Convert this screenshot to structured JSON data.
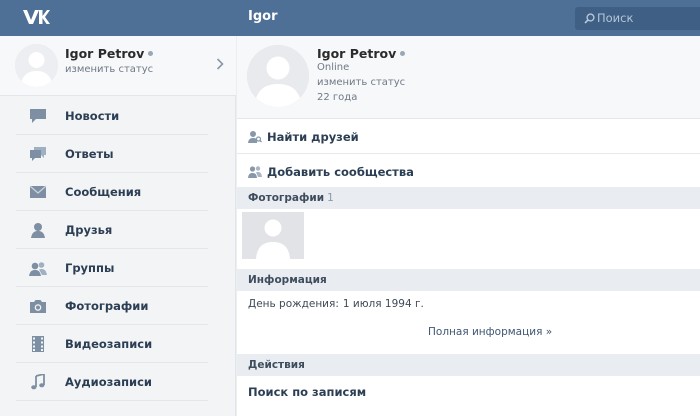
{
  "topbar": {
    "title": "Igor",
    "search_placeholder": "Поиск",
    "accent": "#4e6f96"
  },
  "sidebar": {
    "user": {
      "name": "Igor Petrov",
      "status": "изменить статус"
    },
    "items": [
      {
        "label": "Новости",
        "icon": "news-icon"
      },
      {
        "label": "Ответы",
        "icon": "replies-icon"
      },
      {
        "label": "Сообщения",
        "icon": "messages-icon"
      },
      {
        "label": "Друзья",
        "icon": "friends-icon"
      },
      {
        "label": "Группы",
        "icon": "groups-icon"
      },
      {
        "label": "Фотографии",
        "icon": "camera-icon"
      },
      {
        "label": "Видеозаписи",
        "icon": "video-icon"
      },
      {
        "label": "Аудиозаписи",
        "icon": "music-icon"
      }
    ]
  },
  "profile": {
    "name": "Igor Petrov",
    "online": "Online",
    "status": "изменить статус",
    "age": "22 года"
  },
  "actions": {
    "find_friends": "Найти друзей",
    "add_communities": "Добавить сообщества"
  },
  "photos": {
    "title": "Фотографии",
    "count": "1"
  },
  "info": {
    "title": "Информация",
    "birthday_label": "День рождения:",
    "birthday_value": "1 июля 1994 г.",
    "full_info": "Полная информация »"
  },
  "deeds": {
    "title": "Действия",
    "search_posts": "Поиск по записям"
  }
}
